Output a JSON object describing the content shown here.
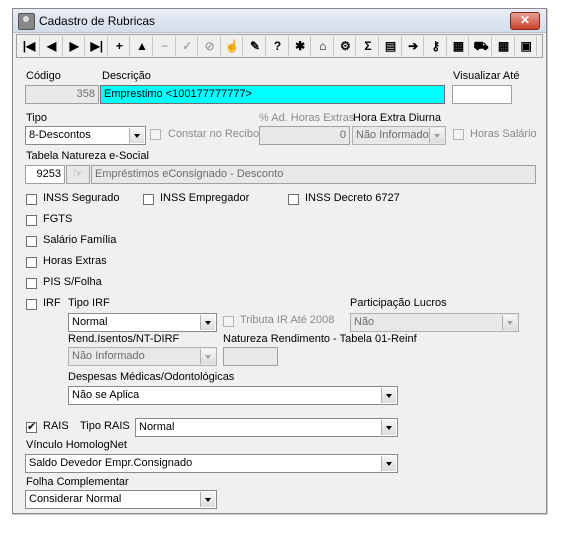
{
  "window": {
    "title": "Cadastro de Rubricas",
    "close_glyph": "✕"
  },
  "toolbar": {
    "buttons": [
      {
        "name": "first-icon",
        "glyph": "|◀"
      },
      {
        "name": "prev-icon",
        "glyph": "◀"
      },
      {
        "name": "next-icon",
        "glyph": "▶"
      },
      {
        "name": "last-icon",
        "glyph": "▶|"
      },
      {
        "name": "insert-icon",
        "glyph": "+"
      },
      {
        "name": "up-icon",
        "glyph": "▲"
      },
      {
        "name": "delete-icon",
        "glyph": "−"
      },
      {
        "name": "post-icon",
        "glyph": "✓"
      },
      {
        "name": "cancel-icon",
        "glyph": "⊘"
      },
      {
        "name": "hand-icon",
        "glyph": "☝"
      },
      {
        "name": "edit-icon",
        "glyph": "✎"
      },
      {
        "name": "help-icon",
        "glyph": "?"
      },
      {
        "name": "tools-icon",
        "glyph": "✱"
      },
      {
        "name": "chart-icon",
        "glyph": "⌂"
      },
      {
        "name": "wizard-icon",
        "glyph": "⚙"
      },
      {
        "name": "sum-icon",
        "glyph": "Σ"
      },
      {
        "name": "document-icon",
        "glyph": "▤"
      },
      {
        "name": "export-icon",
        "glyph": "➔"
      },
      {
        "name": "key-icon",
        "glyph": "⚷"
      },
      {
        "name": "qr-icon",
        "glyph": "▦"
      },
      {
        "name": "truck-icon",
        "glyph": "⛟"
      },
      {
        "name": "calendar-icon",
        "glyph": "▦"
      },
      {
        "name": "exit-icon",
        "glyph": "▣"
      }
    ]
  },
  "fields": {
    "codigo_label": "Código",
    "codigo_value": "358",
    "descricao_label": "Descrição",
    "descricao_value": "Emprestimo <100177777777>",
    "visualizar_label": "Visualizar Até",
    "visualizar_value": "",
    "tipo_label": "Tipo",
    "tipo_value": "8-Descontos",
    "constar_recibo": "Constar no Recibo",
    "ad_horas_label": "% Ad. Horas Extras",
    "ad_horas_value": "0",
    "hora_diurna_label": "Hora Extra Diurna",
    "hora_diurna_value": "Não Informado",
    "horas_salario": "Horas Salário",
    "natureza_label": "Tabela Natureza e-Social",
    "natureza_code": "9253",
    "natureza_desc": "Empréstimos eConsignado - Desconto",
    "inss_segurado": "INSS Segurado",
    "inss_empregador": "INSS Empregador",
    "inss_decreto": "INSS Decreto 6727",
    "fgts": "FGTS",
    "salario_familia": "Salário Família",
    "horas_extras": "Horas Extras",
    "pis": "PIS S/Folha",
    "irf": "IRF",
    "tipo_irf_label": "Tipo IRF",
    "tipo_irf_value": "Normal",
    "tributa_ir": "Tributa IR Até 2008",
    "participacao_label": "Participação Lucros",
    "participacao_value": "Não",
    "rend_label": "Rend.Isentos/NT-DIRF",
    "rend_value": "Não Informado",
    "natureza_rend_label": "Natureza Rendimento - Tabela 01-Reinf",
    "natureza_rend_value": "",
    "despesas_label": "Despesas Médicas/Odontológicas",
    "despesas_value": "Não se Aplica",
    "rais": "RAIS",
    "tipo_rais_label": "Tipo RAIS",
    "tipo_rais_value": "Normal",
    "vinculo_label": "Vínculo HomologNet",
    "vinculo_value": "Saldo Devedor Empr.Consignado",
    "folha_label": "Folha Complementar",
    "folha_value": "Considerar Normal"
  },
  "checked": {
    "rais": true
  }
}
